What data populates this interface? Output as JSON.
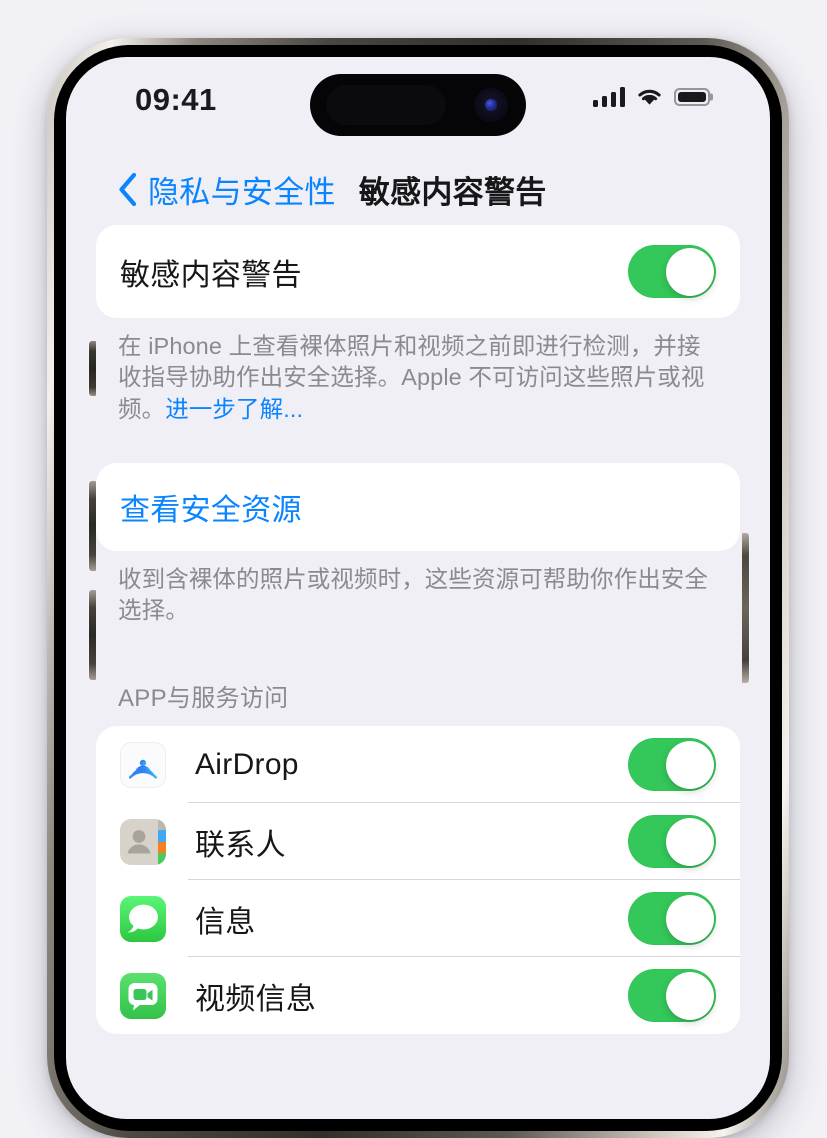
{
  "status_bar": {
    "time": "09:41",
    "cellular_icon": "cellular-bars-icon",
    "wifi_icon": "wifi-icon",
    "battery_icon": "battery-icon"
  },
  "nav": {
    "back_icon": "chevron-left-icon",
    "back_label": "隐私与安全性",
    "title": "敏感内容警告"
  },
  "master_setting": {
    "label": "敏感内容警告",
    "toggle_state": "on",
    "description_prefix": "在 iPhone 上查看裸体照片和视频之前即进行检测，并接收指导协助作出安全选择。Apple 不可访问这些照片或视频。",
    "description_link": "进一步了解..."
  },
  "safety_resources": {
    "label": "查看安全资源",
    "description": "收到含裸体的照片或视频时，这些资源可帮助你作出安全选择。"
  },
  "app_section": {
    "header": "APP与服务访问",
    "items": [
      {
        "name": "AirDrop",
        "icon": "airdrop-icon",
        "toggle_state": "on"
      },
      {
        "name": "联系人",
        "icon": "contacts-icon",
        "toggle_state": "on"
      },
      {
        "name": "信息",
        "icon": "messages-icon",
        "toggle_state": "on"
      },
      {
        "name": "视频信息",
        "icon": "video-messages-icon",
        "toggle_state": "on"
      }
    ]
  },
  "device": {
    "action_button": "action-button",
    "volume_up_button": "volume-up-button",
    "volume_down_button": "volume-down-button",
    "power_button": "power-button"
  },
  "colors": {
    "accent_blue": "#0A84FF",
    "toggle_green": "#34C759",
    "screen_background": "#F1EFF6",
    "card_background": "#FFFFFF",
    "footnote_gray": "#8A8A8F"
  }
}
